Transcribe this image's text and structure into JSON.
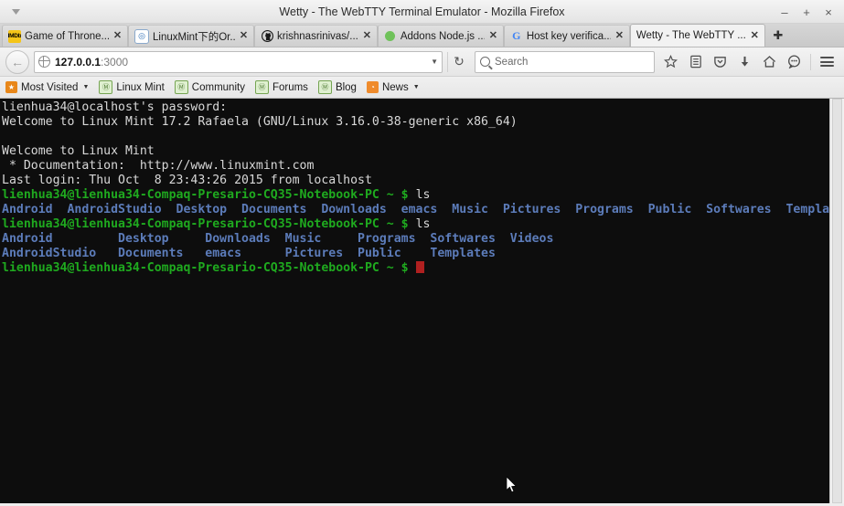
{
  "window": {
    "title": "Wetty - The WebTTY Terminal Emulator - Mozilla Firefox",
    "menu_arrow_icon": "caret-down-icon",
    "minimize_label": "–",
    "maximize_label": "+",
    "close_label": "×"
  },
  "tabs": [
    {
      "label": "Game of Throne...",
      "favicon": "imdb-icon",
      "favicon_text": "IMDb",
      "close_label": "✕",
      "active": false
    },
    {
      "label": "LinuxMint下的Or...",
      "favicon": "linuxmint-icon",
      "favicon_text": "◎",
      "close_label": "✕",
      "active": false
    },
    {
      "label": "krishnasrinivas/...",
      "favicon": "github-icon",
      "favicon_text": "●",
      "close_label": "✕",
      "active": false
    },
    {
      "label": "Addons Node.js ...",
      "favicon": "nodejs-icon",
      "favicon_text": "",
      "close_label": "✕",
      "active": false
    },
    {
      "label": "Host key verifica...",
      "favicon": "google-icon",
      "favicon_text": "G",
      "close_label": "✕",
      "active": false
    },
    {
      "label": "Wetty - The WebTTY ...",
      "favicon": "none-icon",
      "favicon_text": "",
      "close_label": "✕",
      "active": true
    }
  ],
  "new_tab_label": "✚",
  "navbar": {
    "back_icon": "back-arrow-icon",
    "back_label": "←",
    "url_host": "127.0.0.1",
    "url_port": ":3000",
    "url_dropdown_label": "▼",
    "reload_label": "↻",
    "search_placeholder": "Search",
    "icons": [
      {
        "name": "bookmark-star-icon",
        "glyph": "☆"
      },
      {
        "name": "reader-list-icon",
        "glyph": "▤"
      },
      {
        "name": "pocket-icon",
        "glyph": "⬟"
      },
      {
        "name": "downloads-icon",
        "glyph": "⬇"
      },
      {
        "name": "home-icon",
        "glyph": "⌂"
      },
      {
        "name": "chat-icon",
        "glyph": "💬"
      }
    ]
  },
  "bookmarks": [
    {
      "label": "Most Visited",
      "icon": "most-visited-icon",
      "icon_glyph": "★",
      "caret": "▼"
    },
    {
      "label": "Linux Mint",
      "icon": "linuxmint-icon",
      "icon_glyph": "Ⓜ",
      "caret": ""
    },
    {
      "label": "Community",
      "icon": "linuxmint-icon",
      "icon_glyph": "Ⓜ",
      "caret": ""
    },
    {
      "label": "Forums",
      "icon": "linuxmint-icon",
      "icon_glyph": "Ⓜ",
      "caret": ""
    },
    {
      "label": "Blog",
      "icon": "linuxmint-icon",
      "icon_glyph": "Ⓜ",
      "caret": ""
    },
    {
      "label": "News",
      "icon": "rss-icon",
      "icon_glyph": "◔",
      "caret": "▼"
    }
  ],
  "terminal": {
    "prompt": "lienhua34@lienhua34-Compaq-Presario-CQ35-Notebook-PC ~ $ ",
    "lines": [
      {
        "segments": [
          {
            "text": "lienhua34@localhost's password:",
            "color": "white"
          }
        ]
      },
      {
        "segments": [
          {
            "text": "Welcome to Linux Mint 17.2 Rafaela (GNU/Linux 3.16.0-38-generic x86_64)",
            "color": "white"
          }
        ]
      },
      {
        "segments": [
          {
            "text": "",
            "color": "white"
          }
        ]
      },
      {
        "segments": [
          {
            "text": "Welcome to Linux Mint",
            "color": "white"
          }
        ]
      },
      {
        "segments": [
          {
            "text": " * Documentation:  http://www.linuxmint.com",
            "color": "white"
          }
        ]
      },
      {
        "segments": [
          {
            "text": "Last login: Thu Oct  8 23:43:26 2015 from localhost",
            "color": "white"
          }
        ]
      },
      {
        "segments": [
          {
            "text": "lienhua34@lienhua34-Compaq-Presario-CQ35-Notebook-PC ~ $ ",
            "color": "green"
          },
          {
            "text": "ls",
            "color": "white"
          }
        ]
      },
      {
        "segments": [
          {
            "text": "Android  AndroidStudio  Desktop  Documents  Downloads  emacs  Music  Pictures  Programs  Public  Softwares  Templa",
            "color": "blue"
          }
        ]
      },
      {
        "segments": [
          {
            "text": "lienhua34@lienhua34-Compaq-Presario-CQ35-Notebook-PC ~ $ ",
            "color": "green"
          },
          {
            "text": "ls",
            "color": "white"
          }
        ]
      },
      {
        "segments": [
          {
            "text": "Android         Desktop     Downloads  Music     Programs  Softwares  Videos",
            "color": "blue"
          }
        ]
      },
      {
        "segments": [
          {
            "text": "AndroidStudio   Documents   emacs      Pictures  Public    Templates",
            "color": "blue"
          }
        ]
      },
      {
        "segments": [
          {
            "text": "lienhua34@lienhua34-Compaq-Presario-CQ35-Notebook-PC ~ $ ",
            "color": "green"
          },
          {
            "text": "",
            "color": "white"
          },
          {
            "cursor": true
          }
        ]
      }
    ]
  },
  "colors": {
    "terminal_background": "#0d0d0d",
    "prompt_green": "#1faa1f",
    "dir_blue": "#5c7cba",
    "text_white": "#d8d8d8",
    "cursor_red": "#b02020"
  }
}
